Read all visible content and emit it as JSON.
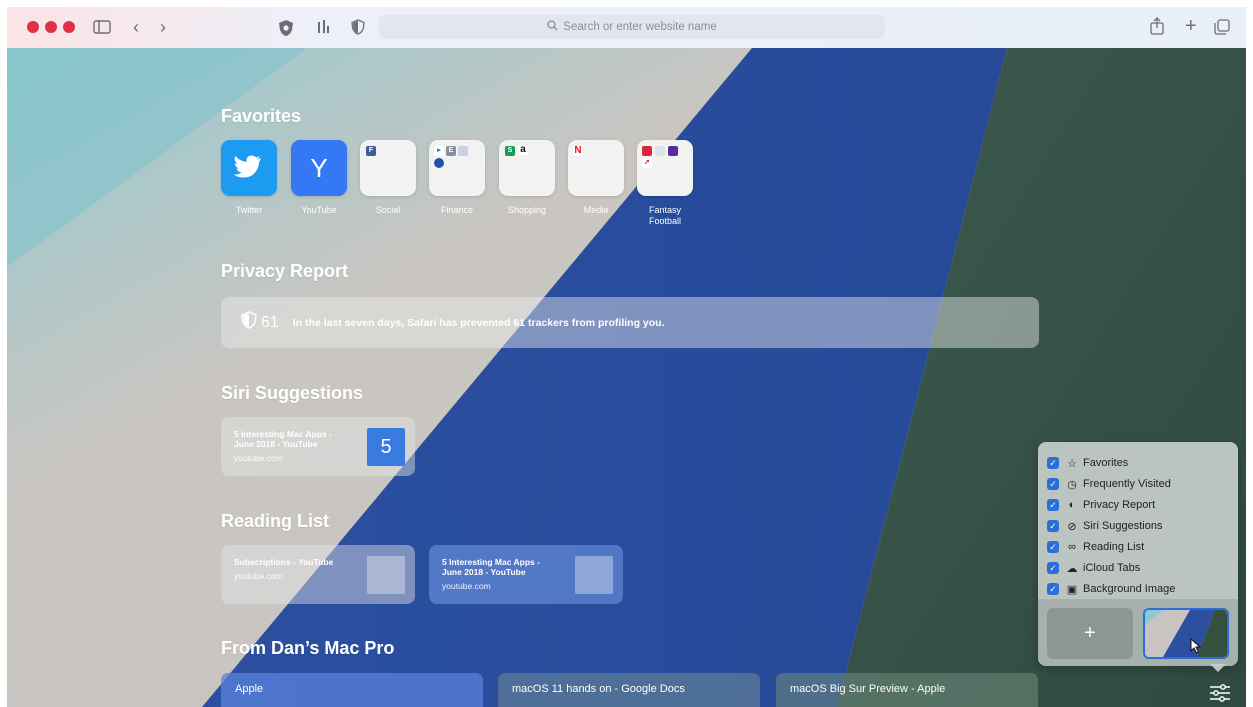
{
  "toolbar": {
    "address_placeholder": "Search or enter website name"
  },
  "favorites": {
    "heading": "Favorites",
    "items": [
      {
        "label": "Twitter"
      },
      {
        "label": "YouTube",
        "letter": "Y"
      },
      {
        "label": "Social",
        "mini": "F"
      },
      {
        "label": "Finance"
      },
      {
        "label": "Shopping",
        "mini": [
          "S",
          "a"
        ]
      },
      {
        "label": "Media",
        "mini": "N"
      },
      {
        "label": "Fantasy Football"
      }
    ]
  },
  "privacy": {
    "heading": "Privacy Report",
    "count": "61",
    "message": "In the last seven days, Safari has prevented 61 trackers from profiling you."
  },
  "siri": {
    "heading": "Siri Suggestions",
    "items": [
      {
        "title": "5 Interesting Mac Apps - June 2018 - YouTube",
        "source": "youtube.com",
        "thumb": "5"
      }
    ]
  },
  "reading": {
    "heading": "Reading List",
    "items": [
      {
        "title": "Subscriptions - YouTube",
        "source": "youtube.com"
      },
      {
        "title": "5 Interesting Mac Apps - June 2018 - YouTube",
        "source": "youtube.com"
      }
    ]
  },
  "icloud": {
    "heading": "From Dan’s Mac Pro",
    "tabs": [
      "Apple",
      "macOS 11 hands on - Google Docs",
      "macOS Big Sur Preview - Apple"
    ]
  },
  "customize": {
    "options": [
      {
        "label": "Favorites",
        "icon": "star-icon"
      },
      {
        "label": "Frequently Visited",
        "icon": "clock-icon"
      },
      {
        "label": "Privacy Report",
        "icon": "shield-icon"
      },
      {
        "label": "Siri Suggestions",
        "icon": "compass-icon"
      },
      {
        "label": "Reading List",
        "icon": "glasses-icon"
      },
      {
        "label": "iCloud Tabs",
        "icon": "cloud-icon"
      },
      {
        "label": "Background Image",
        "icon": "image-icon"
      }
    ],
    "add_label": "+"
  },
  "colors": {
    "accent": "#2b6fd6",
    "twitter": "#1d9bf0",
    "youtube_tile": "#3478f6"
  }
}
